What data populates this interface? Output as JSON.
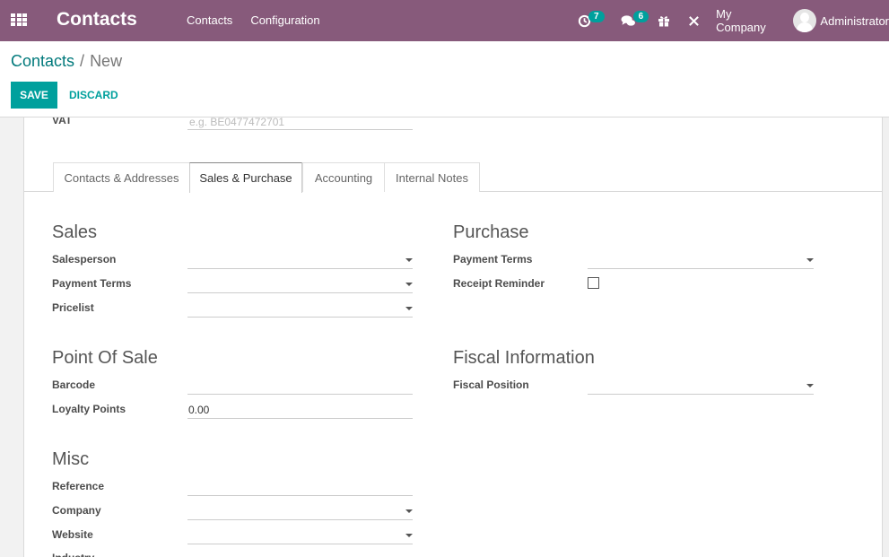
{
  "navbar": {
    "brand": "Contacts",
    "menu": [
      "Contacts",
      "Configuration"
    ],
    "activity_count": "7",
    "messages_count": "6",
    "company": "My Company",
    "user": "Administrator"
  },
  "breadcrumb": {
    "parent": "Contacts",
    "separator": "/",
    "current": "New"
  },
  "actions": {
    "save": "SAVE",
    "discard": "DISCARD"
  },
  "vat": {
    "label": "VAT",
    "placeholder": "e.g. BE0477472701"
  },
  "tabs": [
    {
      "label": "Contacts & Addresses",
      "active": false
    },
    {
      "label": "Sales & Purchase",
      "active": true
    },
    {
      "label": "Accounting",
      "active": false
    },
    {
      "label": "Internal Notes",
      "active": false
    }
  ],
  "sales": {
    "title": "Sales",
    "fields": [
      {
        "label": "Salesperson",
        "value": "",
        "type": "select"
      },
      {
        "label": "Payment Terms",
        "value": "",
        "type": "select"
      },
      {
        "label": "Pricelist",
        "value": "",
        "type": "select"
      }
    ]
  },
  "purchase": {
    "title": "Purchase",
    "fields": [
      {
        "label": "Payment Terms",
        "value": "",
        "type": "select"
      },
      {
        "label": "Receipt Reminder",
        "checked": false,
        "type": "checkbox"
      }
    ]
  },
  "pos": {
    "title": "Point Of Sale",
    "fields": [
      {
        "label": "Barcode",
        "value": "",
        "type": "text"
      },
      {
        "label": "Loyalty Points",
        "value": "0.00",
        "type": "text"
      }
    ]
  },
  "fiscal": {
    "title": "Fiscal Information",
    "fields": [
      {
        "label": "Fiscal Position",
        "value": "",
        "type": "select"
      }
    ]
  },
  "misc": {
    "title": "Misc",
    "fields": [
      {
        "label": "Reference",
        "value": "",
        "type": "text"
      },
      {
        "label": "Company",
        "value": "",
        "type": "select"
      },
      {
        "label": "Website",
        "value": "",
        "type": "select"
      },
      {
        "label": "Industry",
        "value": "",
        "type": "select"
      }
    ]
  }
}
